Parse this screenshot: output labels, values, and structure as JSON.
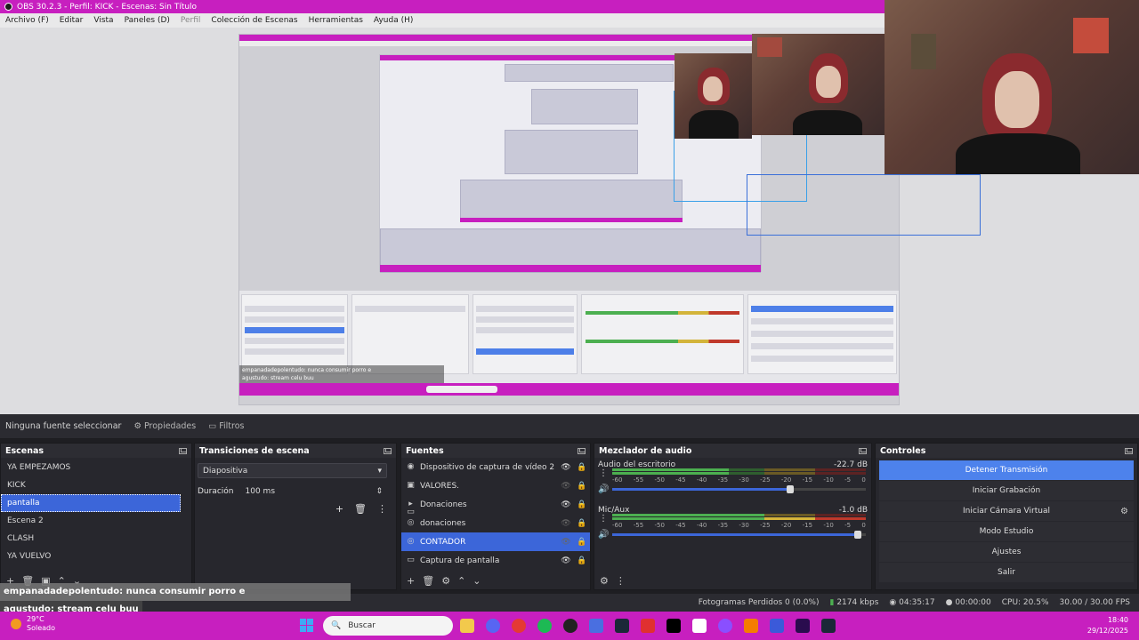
{
  "window": {
    "title": "OBS 30.2.3 - Perfil: KICK - Escenas: Sin Título"
  },
  "menu": [
    {
      "label": "Archivo (F)"
    },
    {
      "label": "Editar"
    },
    {
      "label": "Vista"
    },
    {
      "label": "Paneles (D)"
    },
    {
      "label": "Perfil",
      "dim": true
    },
    {
      "label": "Colección de Escenas"
    },
    {
      "label": "Herramientas"
    },
    {
      "label": "Ayuda (H)"
    }
  ],
  "preview_mini": {
    "chat_user": "empanadadepolentudo",
    "chat_msg": ": nunca consumir porro e",
    "chat2_user": "agustudo",
    "chat2_msg": ": stream celu buu"
  },
  "source_toolbar": {
    "no_source": "Ninguna fuente seleccionar",
    "properties": "Propiedades",
    "filters": "Filtros"
  },
  "scenes": {
    "title": "Escenas",
    "items": [
      "YA EMPEZAMOS",
      "KICK",
      "pantalla",
      "Escena 2",
      "CLASH",
      "YA VUELVO"
    ],
    "selected_index": 2
  },
  "transitions": {
    "title": "Transiciones de escena",
    "type": "Diapositiva",
    "duration_label": "Duración",
    "duration_value": "100 ms"
  },
  "sources": {
    "title": "Fuentes",
    "items": [
      {
        "label": "Dispositivo de captura de vídeo 2",
        "icon": "camera-icon",
        "glyph": "◉",
        "visible": true
      },
      {
        "label": "VALORES.",
        "icon": "image-icon",
        "glyph": "▣",
        "visible": false
      },
      {
        "label": "Donaciones",
        "icon": "folder-icon",
        "glyph": "▸ ▭",
        "visible": true
      },
      {
        "label": "donaciones",
        "icon": "browser-icon",
        "glyph": "◎",
        "visible": false
      },
      {
        "label": "CONTADOR",
        "icon": "browser-icon",
        "glyph": "◎",
        "visible": false,
        "selected": true
      },
      {
        "label": "Captura de pantalla",
        "icon": "monitor-icon",
        "glyph": "▭",
        "visible": true
      }
    ]
  },
  "mixer": {
    "title": "Mezclador de audio",
    "channels": [
      {
        "name": "Audio del escritorio",
        "db": "-22.7 dB",
        "level": 0.46,
        "volume": 0.7
      },
      {
        "name": "Mic/Aux",
        "db": "-1.0 dB",
        "level": 0.92,
        "volume": 0.97
      }
    ],
    "scale": [
      "-60",
      "-55",
      "-50",
      "-45",
      "-40",
      "-35",
      "-30",
      "-25",
      "-20",
      "-15",
      "-10",
      "-5",
      "0"
    ]
  },
  "controls": {
    "title": "Controles",
    "buttons": [
      "Detener Transmisión",
      "Iniciar Grabación",
      "Iniciar Cámara Virtual",
      "Modo Estudio",
      "Ajustes",
      "Salir"
    ]
  },
  "status": {
    "dropped": "Fotogramas Perdidos 0 (0.0%)",
    "bitrate": "2174 kbps",
    "stream_time": "04:35:17",
    "rec_time": "00:00:00",
    "cpu": "CPU: 20.5%",
    "fps": "30.00 / 30.00 FPS"
  },
  "chat": [
    {
      "user": "empanadadepolentudo",
      "msg": ": nunca consumir porro e"
    },
    {
      "user": "agustudo",
      "msg": ": stream celu buu"
    }
  ],
  "taskbar": {
    "temp": "29°C",
    "weather": "Soleado",
    "search_placeholder": "Buscar",
    "time": "18:40",
    "date": "29/12/2025"
  },
  "colors": {
    "accent": "#c71fbf",
    "selection": "#3c66d9",
    "active_button": "#4d82ec"
  }
}
